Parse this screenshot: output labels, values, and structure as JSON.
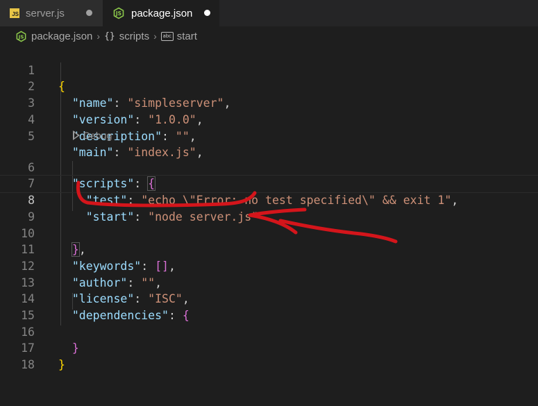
{
  "tabs": [
    {
      "label": "server.js",
      "icon": "javascript-file-icon",
      "active": false,
      "modified": true
    },
    {
      "label": "package.json",
      "icon": "nodejs-file-icon",
      "active": true,
      "modified": true
    }
  ],
  "js_badge": "JS",
  "breadcrumb": {
    "file": "package.json",
    "scripts_symbol": "{}",
    "scripts": "scripts",
    "abc_symbol": "abc",
    "start": "start"
  },
  "codelens": {
    "label": "Debug"
  },
  "current_line": 8,
  "code": {
    "l1": {
      "num": "1"
    },
    "l2": {
      "num": "2",
      "key": "\"name\"",
      "value": "\"simpleserver\""
    },
    "l3": {
      "num": "3",
      "key": "\"version\"",
      "value": "\"1.0.0\""
    },
    "l4": {
      "num": "4",
      "key": "\"description\"",
      "value": "\"\""
    },
    "l5": {
      "num": "5",
      "key": "\"main\"",
      "value": "\"index.js\""
    },
    "l6": {
      "num": "6",
      "key": "\"scripts\""
    },
    "l7": {
      "num": "7",
      "key": "\"test\"",
      "value": "\"echo \\\"Error: no test specified\\\" && exit 1\""
    },
    "l8": {
      "num": "8",
      "key": "\"start\"",
      "value": "\"node server.js\""
    },
    "l9": {
      "num": "9"
    },
    "l10": {
      "num": "10"
    },
    "l11": {
      "num": "11",
      "key": "\"keywords\""
    },
    "l12": {
      "num": "12",
      "key": "\"author\"",
      "value": "\"\""
    },
    "l13": {
      "num": "13",
      "key": "\"license\"",
      "value": "\"ISC\""
    },
    "l14": {
      "num": "14",
      "key": "\"dependencies\""
    },
    "l15": {
      "num": "15"
    },
    "l16": {
      "num": "16"
    },
    "l17": {
      "num": "17"
    },
    "l18": {
      "num": "18"
    }
  },
  "colors": {
    "background": "#1e1e1e",
    "json_key": "#9cdcfe",
    "json_string": "#ce9178",
    "bracket_level1": "#ffd700",
    "bracket_level2": "#da70d6",
    "bracket_level3": "#179fff",
    "annotation_red": "#d4151b"
  }
}
